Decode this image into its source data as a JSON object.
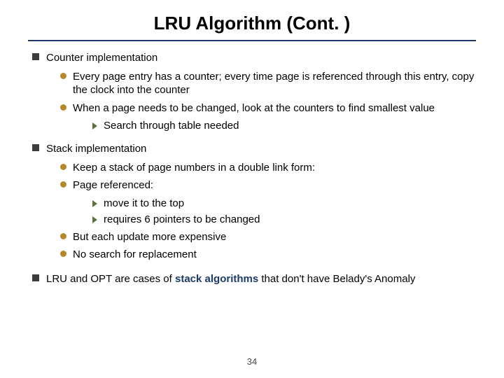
{
  "title": "LRU Algorithm (Cont. )",
  "sec1": {
    "head": "Counter implementation",
    "b1": "Every page entry has a counter; every time page is referenced through this entry, copy the clock into the counter",
    "b2": "When a page needs to be changed, look at the counters to find smallest value",
    "b2a": "Search through table needed"
  },
  "sec2": {
    "head": "Stack implementation",
    "b1": "Keep a stack of page numbers in a double link form:",
    "b2": "Page referenced:",
    "b2a": "move it to the top",
    "b2b": "requires 6 pointers to be changed",
    "b3": "But each update more expensive",
    "b4": "No search for replacement"
  },
  "sec3": {
    "pre": "LRU and OPT are cases of ",
    "bold": "stack algorithms",
    "post": " that don't have Belady's Anomaly"
  },
  "page": "34"
}
